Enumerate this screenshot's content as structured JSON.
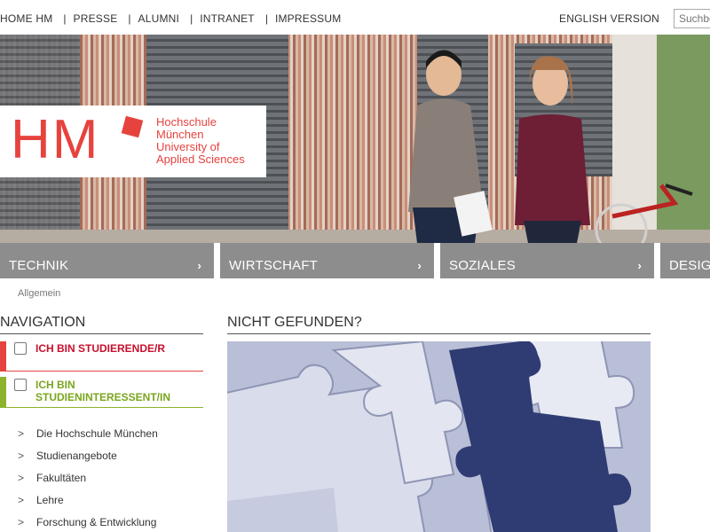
{
  "topnav": {
    "items": [
      "HOME HM",
      "PRESSE",
      "ALUMNI",
      "INTRANET",
      "IMPRESSUM"
    ],
    "separator": "|",
    "english": "ENGLISH VERSION"
  },
  "search": {
    "placeholder": "Suchbe"
  },
  "logo": {
    "mark": "HM",
    "line1": "Hochschule",
    "line2": "München",
    "line3": "University of",
    "line4": "Applied Sciences"
  },
  "categories": [
    {
      "label": "TECHNIK",
      "chevron": "›"
    },
    {
      "label": "WIRTSCHAFT",
      "chevron": "›"
    },
    {
      "label": "SOZIALES",
      "chevron": "›"
    },
    {
      "label": "DESIG",
      "chevron": ""
    }
  ],
  "breadcrumb": "Allgemein",
  "navigation": {
    "title": "NAVIGATION",
    "role1": "ICH BIN STUDIERENDE/R",
    "role2_line1": "ICH BIN",
    "role2_line2": "STUDIENINTERESSENT/IN",
    "arrow": ">",
    "items": [
      "Die Hochschule München",
      "Studienangebote",
      "Fakultäten",
      "Lehre",
      "Forschung & Entwicklung"
    ]
  },
  "main": {
    "title": "NICHT GEFUNDEN?"
  },
  "colors": {
    "accent_red": "#e6433e",
    "accent_green": "#8cb32a",
    "category_gray": "#8d8d8d"
  }
}
